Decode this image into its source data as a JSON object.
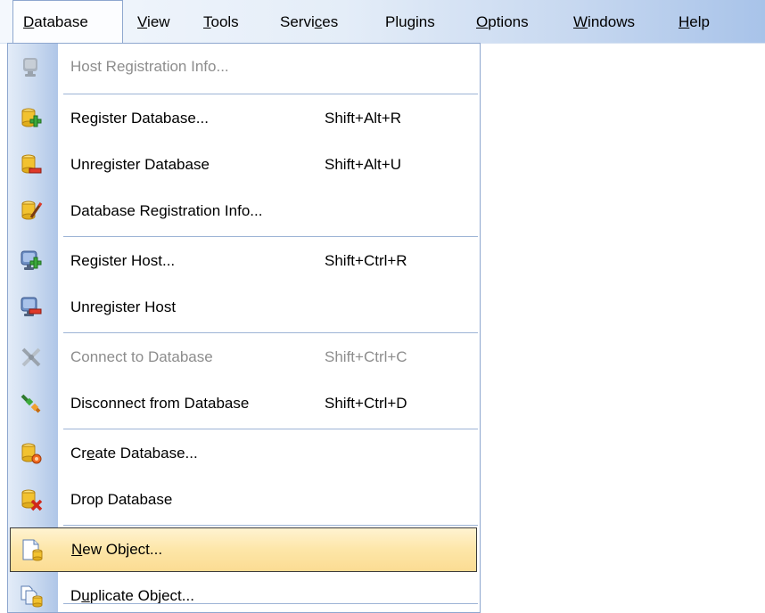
{
  "menubar": {
    "items": [
      {
        "pre": "",
        "key": "D",
        "post": "atabase"
      },
      {
        "pre": "",
        "key": "V",
        "post": "iew"
      },
      {
        "pre": "",
        "key": "T",
        "post": "ools"
      },
      {
        "pre": "Servi",
        "key": "c",
        "post": "es"
      },
      {
        "pre": "Plugins",
        "key": "",
        "post": ""
      },
      {
        "pre": "",
        "key": "O",
        "post": "ptions"
      },
      {
        "pre": "",
        "key": "W",
        "post": "indows"
      },
      {
        "pre": "",
        "key": "H",
        "post": "elp"
      }
    ]
  },
  "menu": {
    "host_registration_info": {
      "label": "Host Registration Info..."
    },
    "register_database": {
      "label": "Register Database...",
      "shortcut": "Shift+Alt+R"
    },
    "unregister_database": {
      "label": "Unregister Database",
      "shortcut": "Shift+Alt+U"
    },
    "database_registration_info": {
      "label": "Database Registration Info..."
    },
    "register_host": {
      "label": "Register Host...",
      "shortcut": "Shift+Ctrl+R"
    },
    "unregister_host": {
      "label": "Unregister Host"
    },
    "connect_to_database": {
      "label": "Connect to Database",
      "shortcut": "Shift+Ctrl+C"
    },
    "disconnect_from_database": {
      "label": "Disconnect from Database",
      "shortcut": "Shift+Ctrl+D"
    },
    "create_database": {
      "pre": "Cr",
      "key": "e",
      "post": "ate Database..."
    },
    "drop_database": {
      "label": "Drop Database"
    },
    "new_object": {
      "pre": "",
      "key": "N",
      "post": "ew Object..."
    },
    "duplicate_object": {
      "pre": "D",
      "key": "u",
      "post": "plicate Object..."
    }
  },
  "colors": {
    "highlight": "#fbdc93",
    "gutter": "#c9d9ef",
    "disabled_text": "#8d8d8d",
    "db_yellow": "#f2c230",
    "add_green": "#3caa3c",
    "remove_red": "#e03a2a"
  }
}
